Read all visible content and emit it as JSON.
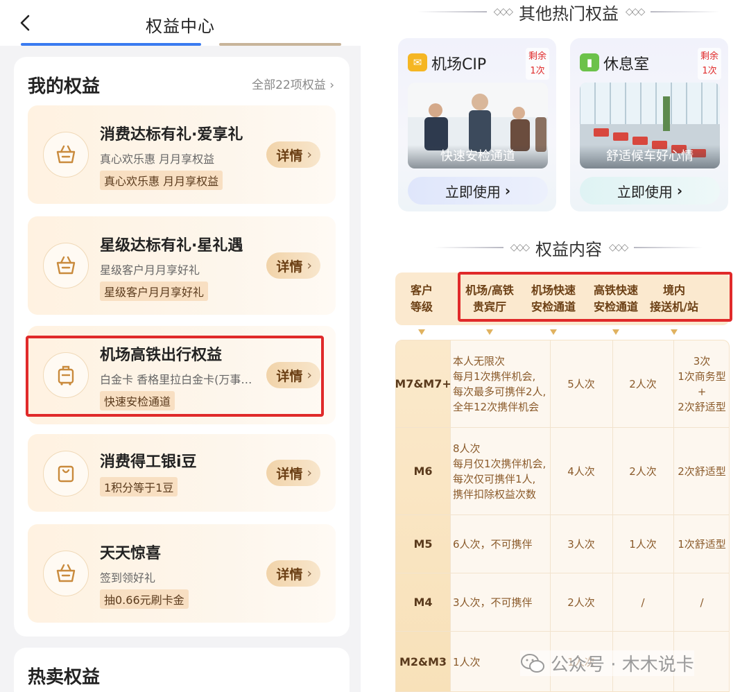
{
  "left": {
    "header": {
      "title": "权益中心"
    },
    "my_benefits": {
      "title": "我的权益",
      "all_link": "全部22项权益",
      "items": [
        {
          "title": "消费达标有礼·爱享礼",
          "subtitle": "真心欢乐惠 月月享权益",
          "tag": "真心欢乐惠 月月享权益",
          "button": "详情",
          "icon": "gift-basket-icon"
        },
        {
          "title": "星级达标有礼·星礼遇",
          "subtitle": "星级客户月月享好礼",
          "tag": "星级客户月月享好礼",
          "button": "详情",
          "icon": "gift-basket-icon"
        },
        {
          "title": "机场高铁出行权益",
          "subtitle": "白金卡 香格里拉白金卡(万事…",
          "tag": "快速安检通道",
          "button": "详情",
          "icon": "luggage-icon"
        },
        {
          "title": "消费得工银i豆",
          "subtitle": "",
          "tag": "1积分等于1豆",
          "button": "详情",
          "icon": "shopping-bag-icon"
        },
        {
          "title": "天天惊喜",
          "subtitle": "签到领好礼",
          "tag": "抽0.66元刷卡金",
          "button": "详情",
          "icon": "gift-basket-icon"
        }
      ]
    },
    "hot": {
      "title": "热卖权益"
    }
  },
  "right": {
    "other_header": "其他热门权益",
    "cards": [
      {
        "name": "机场CIP",
        "remain_line1": "剩余",
        "remain_line2": "1次",
        "caption": "快速安检通道",
        "button": "立即使用",
        "icon": "ticket-icon",
        "icon_color": "#f5b623"
      },
      {
        "name": "休息室",
        "remain_line1": "剩余",
        "remain_line2": "1次",
        "caption": "舒适候车好心情",
        "button": "立即使用",
        "icon": "door-icon",
        "icon_color": "#6cc24a"
      }
    ],
    "content_header": "权益内容",
    "table": {
      "headers": [
        {
          "l1": "客户",
          "l2": "等级"
        },
        {
          "l1": "机场/高铁",
          "l2": "贵宾厅"
        },
        {
          "l1": "机场快速",
          "l2": "安检通道"
        },
        {
          "l1": "高铁快速",
          "l2": "安检通道"
        },
        {
          "l1": "境内",
          "l2": "接送机/站"
        }
      ],
      "rows": [
        {
          "level": "M7&M7+",
          "lounge_lines": [
            "本人无限次",
            "每月1次携伴机会,",
            "每次最多可携伴2人,",
            "全年12次携伴机会"
          ],
          "airport": "5人次",
          "rail": "2人次",
          "transfer_lines": [
            "3次",
            "1次商务型+",
            "2次舒适型"
          ]
        },
        {
          "level": "M6",
          "lounge_lines": [
            "8人次",
            "每月仅1次携伴机会,",
            "每次仅可携伴1人,",
            "携伴扣除权益次数"
          ],
          "airport": "4人次",
          "rail": "2人次",
          "transfer_lines": [
            "2次舒适型"
          ]
        },
        {
          "level": "M5",
          "lounge_lines": [
            "6人次，不可携伴"
          ],
          "airport": "3人次",
          "rail": "1人次",
          "transfer_lines": [
            "1次舒适型"
          ]
        },
        {
          "level": "M4",
          "lounge_lines": [
            "3人次，不可携伴"
          ],
          "airport": "2人次",
          "rail": "/",
          "transfer_lines": [
            "/"
          ]
        },
        {
          "level": "M2&M3",
          "lounge_lines": [
            "1人次"
          ],
          "airport": "1人次",
          "rail": "",
          "transfer_lines": [
            ""
          ]
        }
      ]
    },
    "watermark": "公众号 · 木木说卡"
  }
}
